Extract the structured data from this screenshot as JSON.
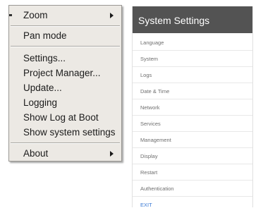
{
  "context_menu": {
    "items": [
      {
        "label": "Zoom",
        "submenu": true
      },
      {
        "label": "Pan mode",
        "submenu": false
      },
      {
        "label": "Settings...",
        "submenu": false
      },
      {
        "label": "Project Manager...",
        "submenu": false
      },
      {
        "label": "Update...",
        "submenu": false
      },
      {
        "label": "Logging",
        "submenu": false
      },
      {
        "label": "Show Log at Boot",
        "submenu": false
      },
      {
        "label": "Show system settings",
        "submenu": false
      },
      {
        "label": "About",
        "submenu": true
      }
    ],
    "submenu_icon": "triangle-right-icon"
  },
  "settings_panel": {
    "title": "System Settings",
    "header_color": "#535353",
    "items": [
      {
        "label": "Language"
      },
      {
        "label": "System"
      },
      {
        "label": "Logs"
      },
      {
        "label": "Date & Time"
      },
      {
        "label": "Network"
      },
      {
        "label": "Services"
      },
      {
        "label": "Management"
      },
      {
        "label": "Display"
      },
      {
        "label": "Restart"
      },
      {
        "label": "Authentication"
      },
      {
        "label": "EXIT"
      }
    ],
    "exit_color": "#3a7ad5"
  }
}
